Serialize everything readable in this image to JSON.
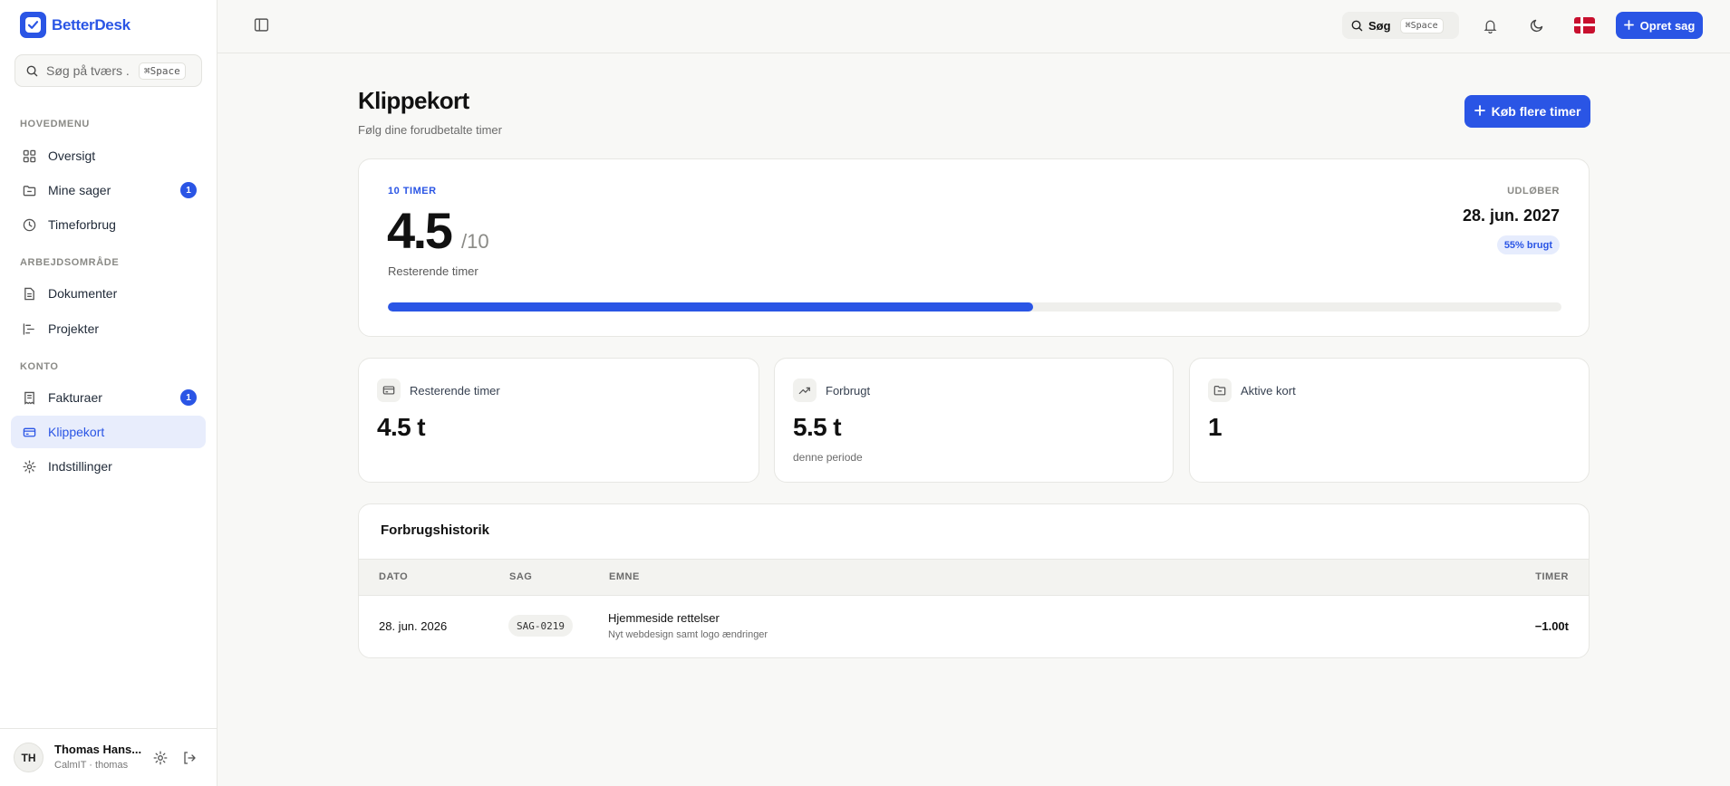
{
  "app": {
    "name": "BetterDesk",
    "brand_color": "#2a55e5"
  },
  "sidebar": {
    "search_placeholder": "Søg på tværs ...",
    "search_shortcut": "⌘Space",
    "sections": {
      "main": "HOVEDMENU",
      "workspace": "ARBEJDSOMRÅDE",
      "account": "KONTO"
    },
    "items": [
      {
        "label": "Oversigt",
        "icon": "grid-icon"
      },
      {
        "label": "Mine sager",
        "icon": "folder-icon",
        "badge": "1"
      },
      {
        "label": "Timeforbrug",
        "icon": "clock-icon"
      },
      {
        "label": "Dokumenter",
        "icon": "document-icon"
      },
      {
        "label": "Projekter",
        "icon": "gantt-icon"
      },
      {
        "label": "Fakturaer",
        "icon": "receipt-icon",
        "badge": "1"
      },
      {
        "label": "Klippekort",
        "icon": "card-icon",
        "active": true
      },
      {
        "label": "Indstillinger",
        "icon": "gear-icon"
      }
    ],
    "user": {
      "initials": "TH",
      "name": "Thomas Hans...",
      "subtitle": "CalmIT · thomas"
    }
  },
  "header": {
    "search_label": "Søg",
    "search_shortcut": "⌘Space",
    "create_button": "Opret sag"
  },
  "page": {
    "title": "Klippekort",
    "subtitle": "Følg dine forudbetalte timer",
    "buy_button": "Køb flere timer"
  },
  "hero": {
    "label": "10 TIMER",
    "remaining": "4.5",
    "total": "/10",
    "remaining_label": "Resterende timer",
    "expires_label": "UDLØBER",
    "expires_date": "28. jun. 2027",
    "used_pill": "55% brugt",
    "used_fraction": 0.55
  },
  "stats": [
    {
      "icon": "card-icon",
      "label": "Resterende timer",
      "value": "4.5 t",
      "note": ""
    },
    {
      "icon": "trend-up-icon",
      "label": "Forbrugt",
      "value": "5.5 t",
      "note": "denne periode"
    },
    {
      "icon": "folder-icon",
      "label": "Aktive kort",
      "value": "1",
      "note": ""
    }
  ],
  "history": {
    "title": "Forbrugshistorik",
    "columns": {
      "date": "DATO",
      "case": "SAG",
      "subject": "EMNE",
      "hours": "TIMER"
    },
    "rows": [
      {
        "date": "28. jun. 2026",
        "case": "SAG-0219",
        "subject": "Hjemmeside rettelser",
        "description": "Nyt webdesign samt logo ændringer",
        "hours": "−1.00t"
      }
    ]
  }
}
